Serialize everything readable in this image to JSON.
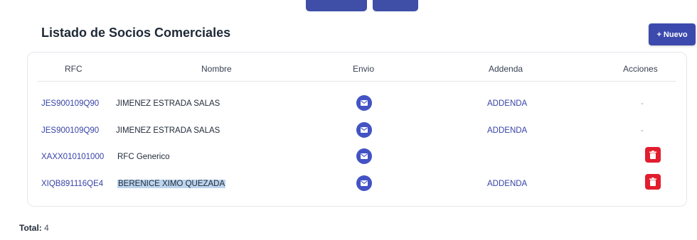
{
  "page": {
    "title": "Listado de Socios Comerciales",
    "new_button_label": "+ Nuevo",
    "total_label": "Total:",
    "total_value": "4"
  },
  "table": {
    "headers": {
      "rfc": "RFC",
      "nombre": "Nombre",
      "envio": "Envio",
      "addenda": "Addenda",
      "acciones": "Acciones"
    },
    "rows": [
      {
        "rfc": "JES900109Q90",
        "nombre": "JIMENEZ ESTRADA SALAS",
        "addenda": "ADDENDA",
        "accion": "-"
      },
      {
        "rfc": "JES900109Q90",
        "nombre": "JIMENEZ ESTRADA SALAS",
        "addenda": "ADDENDA",
        "accion": "-"
      },
      {
        "rfc": "XAXX010101000",
        "nombre": "RFC Generico",
        "addenda": "",
        "accion": "delete"
      },
      {
        "rfc": "XIQB891116QE4",
        "nombre": "BERENICE XIMO QUEZADA",
        "addenda": "ADDENDA",
        "accion": "delete"
      }
    ]
  },
  "icons": {
    "envio": "mail-icon",
    "delete": "trash-icon"
  },
  "colors": {
    "primary": "#3d4aad",
    "link": "#3743a8",
    "mail_button": "#4352c4",
    "delete_button": "#e11d2e",
    "selection_highlight": "#bcd4ee"
  }
}
